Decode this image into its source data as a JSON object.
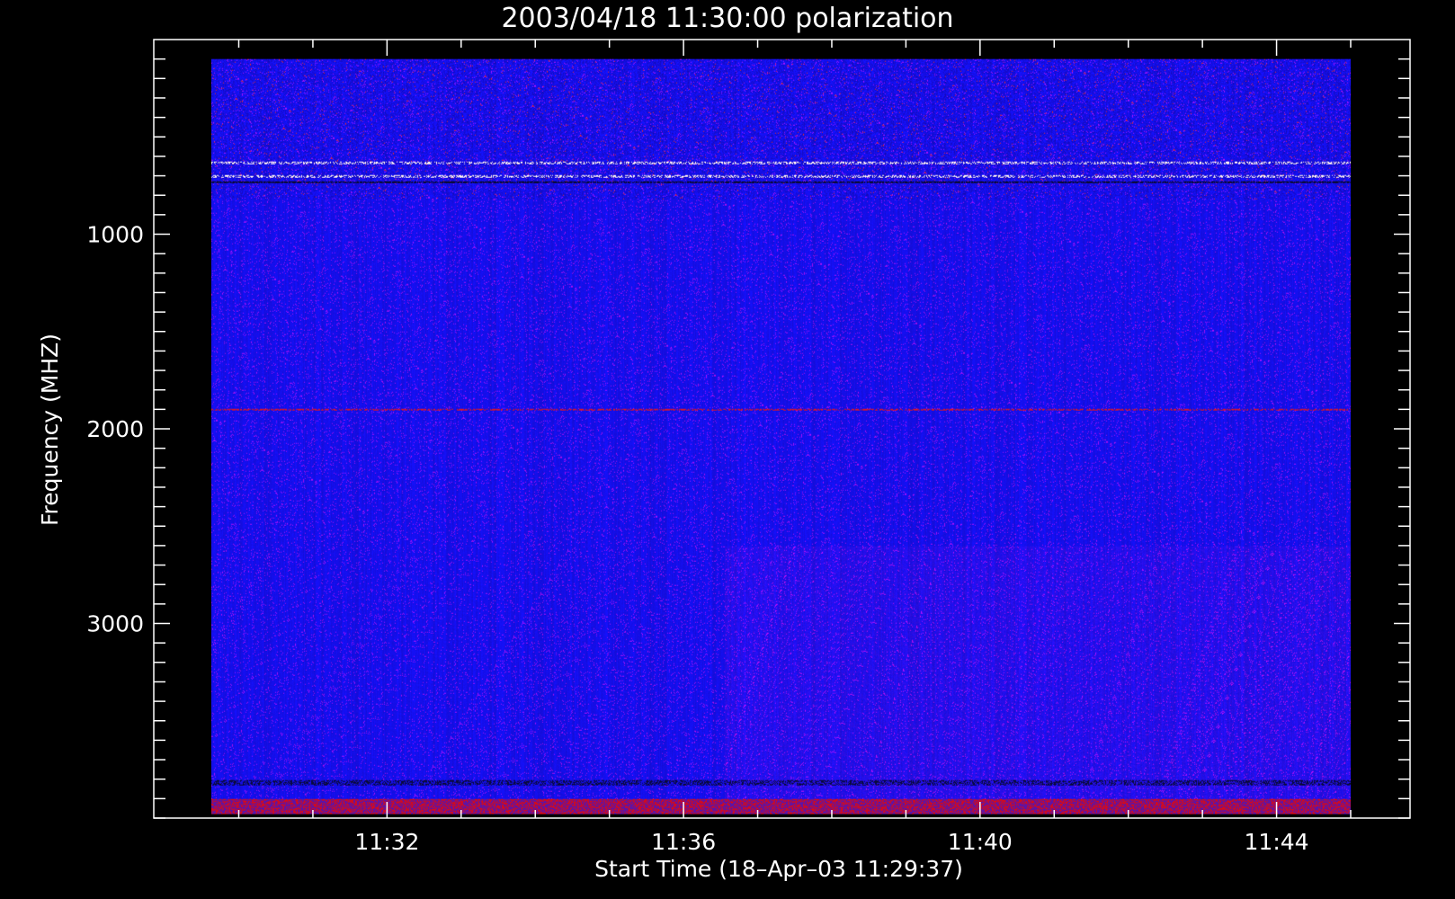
{
  "chart_data": {
    "type": "heatmap",
    "title": "2003/04/18 11:30:00 polarization",
    "xlabel": "Start Time (18–Apr–03 11:29:37)",
    "ylabel": "Frequency (MHZ)",
    "x_tick_labels": [
      "11:32",
      "11:36",
      "11:40",
      "11:44"
    ],
    "x_ticks_minutes": [
      32,
      36,
      40,
      44
    ],
    "x_range_minutes": [
      29.63,
      45.0
    ],
    "y_tick_values": [
      1000,
      2000,
      3000
    ],
    "y_tick_labels": [
      "1000",
      "2000",
      "3000"
    ],
    "y_range": [
      0,
      4000
    ],
    "y_inverted": true,
    "y_data_range": [
      100,
      3980
    ],
    "colors": {
      "background": "#000000",
      "axes": "#ffffff",
      "base": "#1a1aff",
      "low": "#0000a0",
      "high": "#d01010",
      "peak": "#ffffff"
    },
    "features": [
      {
        "kind": "noise-band",
        "freq_range": [
          200,
          800
        ]
      },
      {
        "kind": "bright-line",
        "freq": 630
      },
      {
        "kind": "bright-line",
        "freq": 700
      },
      {
        "kind": "dark-line",
        "freq": 730
      },
      {
        "kind": "red-line",
        "freq": 1900
      },
      {
        "kind": "dark-band",
        "freq_range": [
          3800,
          3830
        ]
      },
      {
        "kind": "red-band",
        "freq_range": [
          3900,
          3980
        ]
      }
    ]
  }
}
